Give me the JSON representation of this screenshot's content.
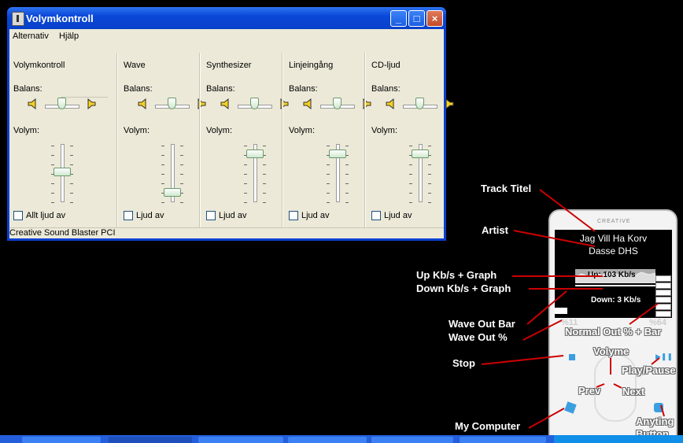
{
  "window": {
    "title": "Volymkontroll",
    "menu": [
      "Alternativ",
      "Hjälp"
    ],
    "status": "Creative Sound Blaster PCI",
    "controls": {
      "minimize": "_",
      "maximize": "□",
      "close": "×"
    }
  },
  "mixer": {
    "balance_label": "Balans:",
    "volume_label": "Volym:",
    "channels": [
      {
        "name": "Volymkontroll",
        "mute_label": "Allt ljud av",
        "volume": 0.55,
        "balance": 0.5
      },
      {
        "name": "Wave",
        "mute_label": "Ljud av",
        "volume": 0.15,
        "balance": 0.5
      },
      {
        "name": "Synthesizer",
        "mute_label": "Ljud av",
        "volume": 0.9,
        "balance": 0.5
      },
      {
        "name": "Linjeingång",
        "mute_label": "Ljud av",
        "volume": 0.9,
        "balance": 0.5
      },
      {
        "name": "CD-ljud",
        "mute_label": "Ljud av",
        "volume": 0.9,
        "balance": 0.5
      }
    ]
  },
  "player": {
    "brand": "CREATIVE",
    "track": "Jag Vill Ha Korv",
    "artist": "Dasse DHS",
    "up": "Up: 103 Kb/s",
    "down": "Down: 3 Kb/s",
    "wave_pct": "%11",
    "normal_pct": "%64"
  },
  "annotations": {
    "track_title": "Track Titel",
    "artist": "Artist",
    "up_graph": "Up Kb/s + Graph",
    "down_graph": "Down Kb/s + Graph",
    "wave_bar": "Wave Out Bar",
    "wave_pct": "Wave Out %",
    "normal_out": "Normal Out % + Bar",
    "volume": "Volyme",
    "play_pause": "Play/Pause",
    "stop": "Stop",
    "prev": "Prev",
    "next": "Next",
    "my_computer": "My Computer",
    "anything": "Anyting",
    "button": "Button"
  },
  "colors": {
    "title_blue": "#0a48d8",
    "window_bg": "#ece9d8",
    "annotation_line": "#cc0000"
  }
}
